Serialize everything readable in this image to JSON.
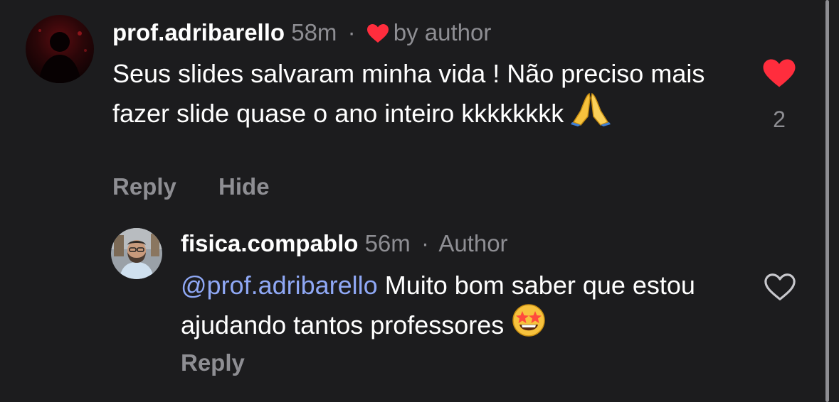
{
  "comments": [
    {
      "username": "prof.adribarello",
      "time": "58m",
      "separator": "·",
      "badge": "by author",
      "badge_icon": "heart-icon",
      "text": "Seus slides salvaram minha vida ! Não preciso mais fazer slide quase o ano inteiro kkkkkkkk",
      "emoji": "folded-hands",
      "actions": [
        "Reply",
        "Hide"
      ],
      "liked": true,
      "like_count": "2",
      "like_color": "#ff2d3d"
    },
    {
      "username": "fisica.compablo",
      "time": "56m",
      "separator": "·",
      "badge": "Author",
      "mention": "@prof.adribarello",
      "text": "Muito bom saber que estou ajudando tantos professores",
      "emoji": "star-struck",
      "actions": [
        "Reply"
      ],
      "liked": false
    }
  ],
  "colors": {
    "background": "#1c1c1e",
    "secondary_text": "#8e8e93",
    "mention": "#8fa8f5",
    "heart_red": "#ff2d3d"
  }
}
